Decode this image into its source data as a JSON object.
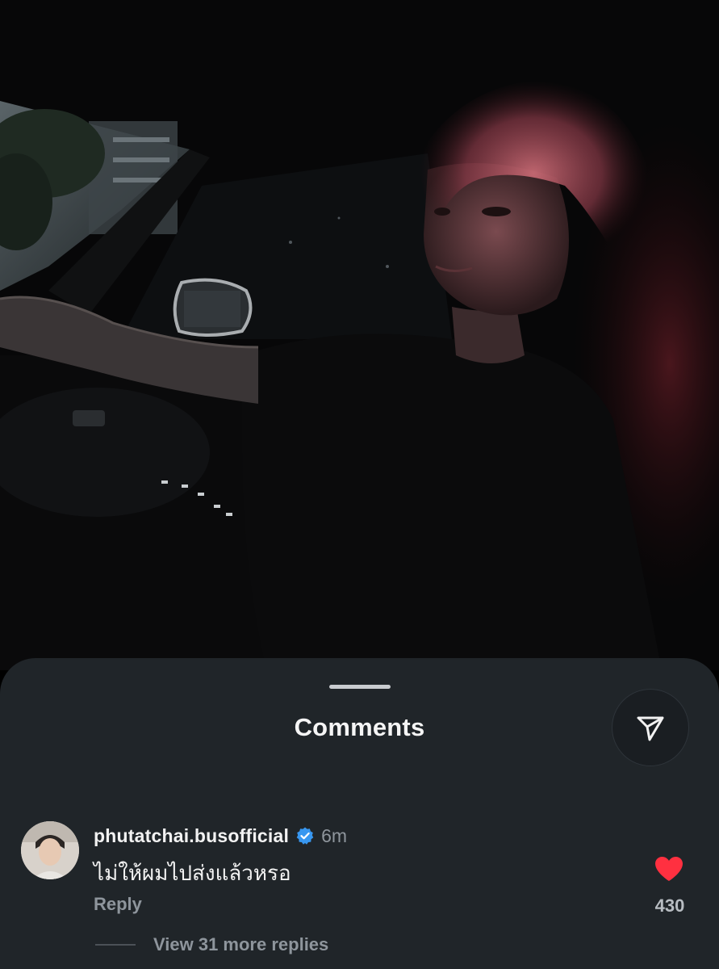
{
  "sheet": {
    "title": "Comments",
    "share_icon": "paper-plane-icon"
  },
  "comment": {
    "username": "phutatchai.busofficial",
    "verified_icon": "verified-badge-icon",
    "verified_color": "#3897f0",
    "timestamp": "6m",
    "text": "ไม่ให้ผมไปส่งแล้วหรอ",
    "reply_label": "Reply",
    "like_icon": "heart-icon",
    "like_color": "#ff3040",
    "liked": true,
    "like_count": "430",
    "more_replies_label": "View 31 more replies"
  },
  "colors": {
    "sheet_background": "#202529",
    "secondary_text": "#8e959c"
  }
}
